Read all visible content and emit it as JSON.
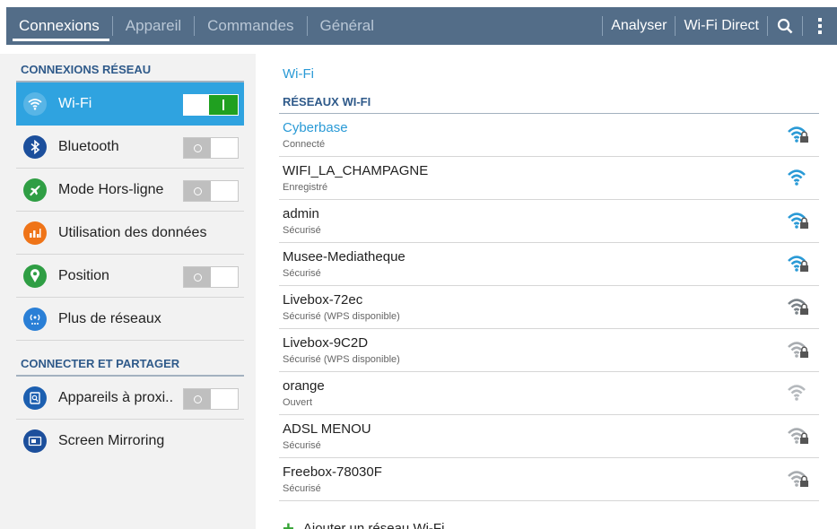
{
  "topbar": {
    "tabs": [
      {
        "label": "Connexions",
        "active": true
      },
      {
        "label": "Appareil",
        "active": false
      },
      {
        "label": "Commandes",
        "active": false
      },
      {
        "label": "Général",
        "active": false
      }
    ],
    "actions": {
      "scan": "Analyser",
      "wifi_direct": "Wi-Fi Direct"
    },
    "icons": {
      "search": "search-icon",
      "more": "more-vert-icon"
    },
    "colors": {
      "bar": "#536d88",
      "active_text": "#ffffff",
      "inactive_text": "#b9c7d6"
    }
  },
  "sidebar": {
    "section1": "CONNEXIONS RÉSEAU",
    "section2": "CONNECTER ET PARTAGER",
    "items": [
      {
        "label": "Wi-Fi",
        "icon": "wifi-icon",
        "icon_color": "#2a9ad6",
        "toggle": "on",
        "selected": true
      },
      {
        "label": "Bluetooth",
        "icon": "bluetooth-icon",
        "icon_color": "#1c4f9c",
        "toggle": "off",
        "selected": false
      },
      {
        "label": "Mode Hors-ligne",
        "icon": "airplane-icon",
        "icon_color": "#2f9e44",
        "toggle": "off",
        "selected": false
      },
      {
        "label": "Utilisation des données",
        "icon": "data-usage-icon",
        "icon_color": "#ef7418",
        "toggle": "none",
        "selected": false
      },
      {
        "label": "Position",
        "icon": "location-icon",
        "icon_color": "#2f9e44",
        "toggle": "off",
        "selected": false
      },
      {
        "label": "Plus de réseaux",
        "icon": "more-networks-icon",
        "icon_color": "#2a7fd6",
        "toggle": "none",
        "selected": false
      },
      {
        "label": "Appareils à proxi..",
        "icon": "nearby-devices-icon",
        "icon_color": "#1c5fb0",
        "toggle": "off",
        "selected": false
      },
      {
        "label": "Screen Mirroring",
        "icon": "screen-mirroring-icon",
        "icon_color": "#1c4f9c",
        "toggle": "none",
        "selected": false
      }
    ],
    "colors": {
      "selected_bg": "#2fa3e0",
      "toggle_on": "#20a020"
    }
  },
  "main": {
    "title": "Wi-Fi",
    "networks_header": "RÉSEAUX WI-FI",
    "networks": [
      {
        "name": "Cyberbase",
        "status": "Connecté",
        "signal_icon": "wifi-locked-icon",
        "secured": true,
        "signal_color": "#2a9ad6",
        "connected": true
      },
      {
        "name": "WIFI_LA_CHAMPAGNE",
        "status": "Enregistré",
        "signal_icon": "wifi-signal-icon",
        "secured": false,
        "signal_color": "#2a9ad6",
        "connected": false
      },
      {
        "name": "admin",
        "status": "Sécurisé",
        "signal_icon": "wifi-locked-icon",
        "secured": true,
        "signal_color": "#2a9ad6",
        "connected": false
      },
      {
        "name": "Musee-Mediatheque",
        "status": "Sécurisé",
        "signal_icon": "wifi-locked-icon",
        "secured": true,
        "signal_color": "#2a9ad6",
        "connected": false
      },
      {
        "name": "Livebox-72ec",
        "status": "Sécurisé (WPS disponible)",
        "signal_icon": "wifi-locked-icon",
        "secured": true,
        "signal_color": "#7a8288",
        "connected": false
      },
      {
        "name": "Livebox-9C2D",
        "status": "Sécurisé (WPS disponible)",
        "signal_icon": "wifi-locked-icon",
        "secured": true,
        "signal_color": "#a8acb0",
        "connected": false
      },
      {
        "name": "orange",
        "status": "Ouvert",
        "signal_icon": "wifi-signal-icon",
        "secured": false,
        "signal_color": "#b5b9bd",
        "connected": false
      },
      {
        "name": "ADSL MENOU",
        "status": "Sécurisé",
        "signal_icon": "wifi-locked-icon",
        "secured": true,
        "signal_color": "#a8acb0",
        "connected": false
      },
      {
        "name": "Freebox-78030F",
        "status": "Sécurisé",
        "signal_icon": "wifi-locked-icon",
        "secured": true,
        "signal_color": "#a8acb0",
        "connected": false
      }
    ],
    "add_network": "Ajouter un réseau Wi-Fi",
    "add_icon": "plus-icon",
    "colors": {
      "accent": "#2a9ad6",
      "section": "#2f5a8a"
    }
  }
}
